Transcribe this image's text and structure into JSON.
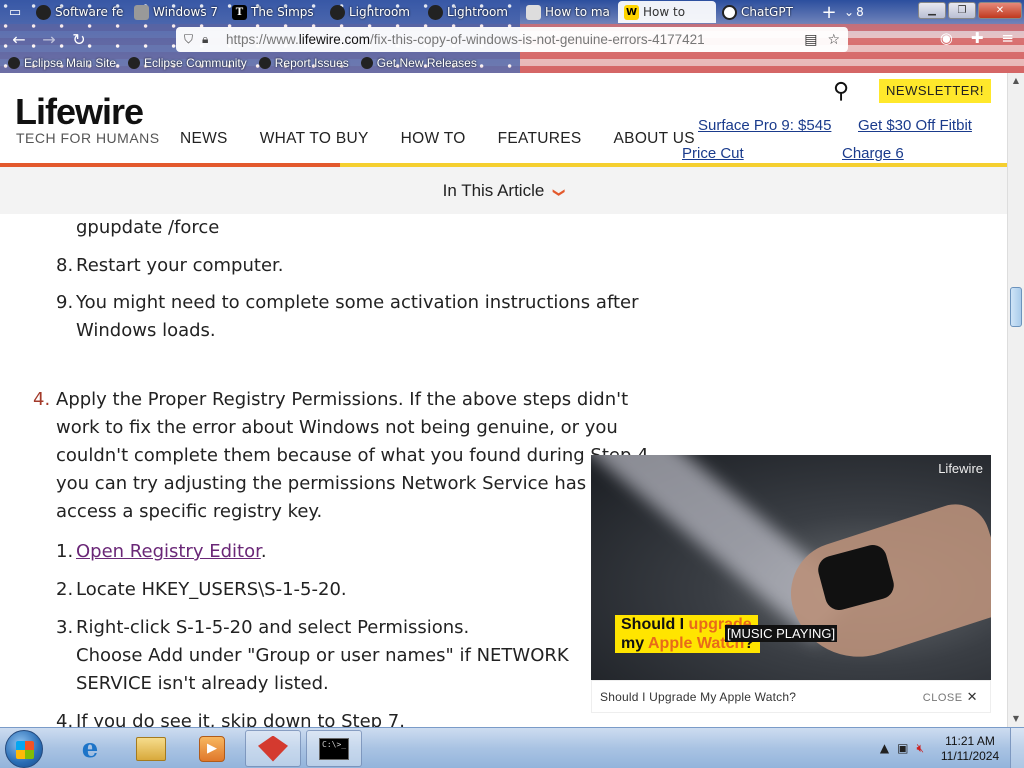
{
  "browser": {
    "tabs": [
      {
        "label": "Software fe",
        "icon": "github-icon"
      },
      {
        "label": "Windows 7",
        "icon": "windows-icon"
      },
      {
        "label": "The Simps",
        "icon": "nyt-icon"
      },
      {
        "label": "Lightroom",
        "icon": "github-icon"
      },
      {
        "label": "Lightroom",
        "icon": "github-icon"
      },
      {
        "label": "How to ma",
        "icon": "document-icon"
      },
      {
        "label": "How to",
        "icon": "lifewire-icon"
      },
      {
        "label": "ChatGPT",
        "icon": "chatgpt-icon"
      }
    ],
    "new_tab": "+",
    "tab_count": "8",
    "window_controls": {
      "min": "▁",
      "max": "❐",
      "close": "✕"
    },
    "url": {
      "prefix": "https://www.",
      "domain": "lifewire.com",
      "path": "/fix-this-copy-of-windows-is-not-genuine-errors-4177421"
    },
    "bookmarks": [
      "Eclipse Main Site",
      "Eclipse Community",
      "Report Issues",
      "Get New Releases"
    ]
  },
  "site": {
    "logo": "Lifewire",
    "tagline": "TECH FOR HUMANS",
    "nav": [
      "NEWS",
      "WHAT TO BUY",
      "HOW TO",
      "FEATURES",
      "ABOUT US"
    ],
    "newsletter": "NEWSLETTER!",
    "promos": [
      "Surface Pro 9: $545",
      "Get $30 Off Fitbit",
      "Price Cut",
      "Charge 6"
    ],
    "toc_label": "In This Article",
    "toc_chevron": "❯"
  },
  "article": {
    "cmd_line": "gpupdate /force",
    "step8_num": "8.",
    "step8": "Restart your computer.",
    "step9_num": "9.",
    "step9_a": "You might need to complete some activation instructions after",
    "step9_b": "Windows loads.",
    "sec4_num": "4.",
    "sec4_a": "Apply the Proper Registry Permissions. If the above steps didn't",
    "sec4_b": "work to fix the error about Windows not being genuine, or you",
    "sec4_c": "couldn't complete them because of what you found during Step 4,",
    "sec4_d": "you can try adjusting the permissions Network Service has to",
    "sec4_e": "access a specific registry key.",
    "s1_num": "1.",
    "s1_link": "Open Registry Editor",
    "s1_tail": ".",
    "s2_num": "2.",
    "s2": "Locate HKEY_USERS\\S-1-5-20.",
    "s3_num": "3.",
    "s3_a": "Right-click S-1-5-20 and select Permissions.",
    "s3_b": "Choose Add under \"Group or user names\" if NETWORK",
    "s3_c": "SERVICE isn't already listed.",
    "s4_num": "4.",
    "s4": "If you do see it, skip down to Step 7."
  },
  "video": {
    "brand": "Lifewire",
    "caption_1a": "Should I ",
    "caption_1b": "upgrade",
    "caption_2a": "my ",
    "caption_2b": "Apple Watch",
    "caption_2c": "?",
    "music": "[MUSIC PLAYING]",
    "footer_title": "Should I Upgrade My Apple Watch?",
    "close_label": "CLOSE",
    "close_icon": "✕"
  },
  "taskbar": {
    "time": "11:21 AM",
    "date": "11/11/2024",
    "cmd_text": "C:\\>_"
  },
  "colors": {
    "accent_orange": "#e3592c",
    "accent_yellow": "#f5cf2f",
    "link_purple": "#6a2777",
    "promo_blue": "#1a3b8c"
  }
}
